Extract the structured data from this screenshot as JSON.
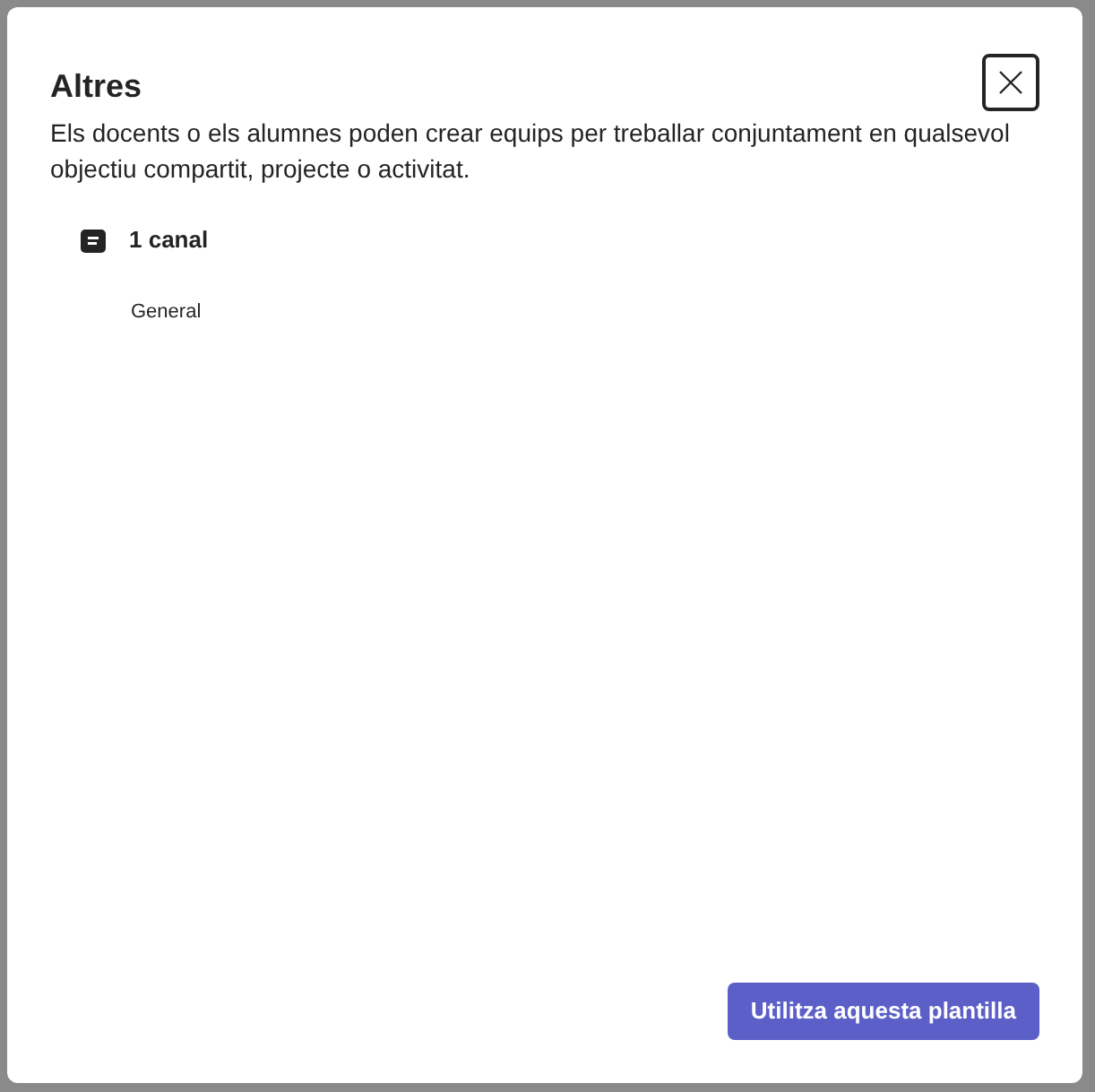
{
  "dialog": {
    "title": "Altres",
    "description": "Els docents o els alumnes poden crear equips per treballar conjuntament en qualsevol objectiu compartit, projecte o activitat.",
    "channel_count": "1 canal",
    "channels": [
      "General"
    ],
    "primary_button": "Utilitza aquesta plantilla"
  }
}
